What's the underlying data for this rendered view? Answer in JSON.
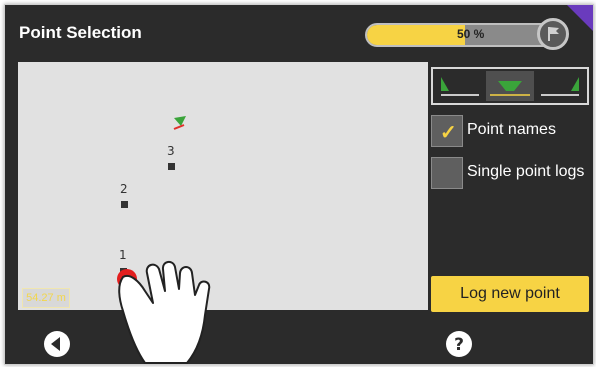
{
  "header": {
    "title": "Point Selection",
    "progress_label": "50 %",
    "progress_value": 0.5
  },
  "map": {
    "points": [
      {
        "label": "1"
      },
      {
        "label": "2"
      },
      {
        "label": "3"
      }
    ],
    "scale_label": "54.27 m"
  },
  "view_modes": {
    "icons": [
      "left-slope-view-icon",
      "center-cut-view-icon",
      "right-slope-view-icon"
    ],
    "active_index": 1
  },
  "options": {
    "point_names": {
      "label": "Point names",
      "checked": true
    },
    "single_point_logs": {
      "label": "Single point logs",
      "checked": false
    }
  },
  "actions": {
    "log_new_point": "Log new point"
  },
  "footer": {
    "back_icon": "back-arrow-icon",
    "help_icon": "help-icon"
  },
  "colors": {
    "accent": "#f7d344",
    "green": "#3aa43a",
    "purple": "#6a3bbd",
    "map_bg": "#e1e1e1"
  }
}
